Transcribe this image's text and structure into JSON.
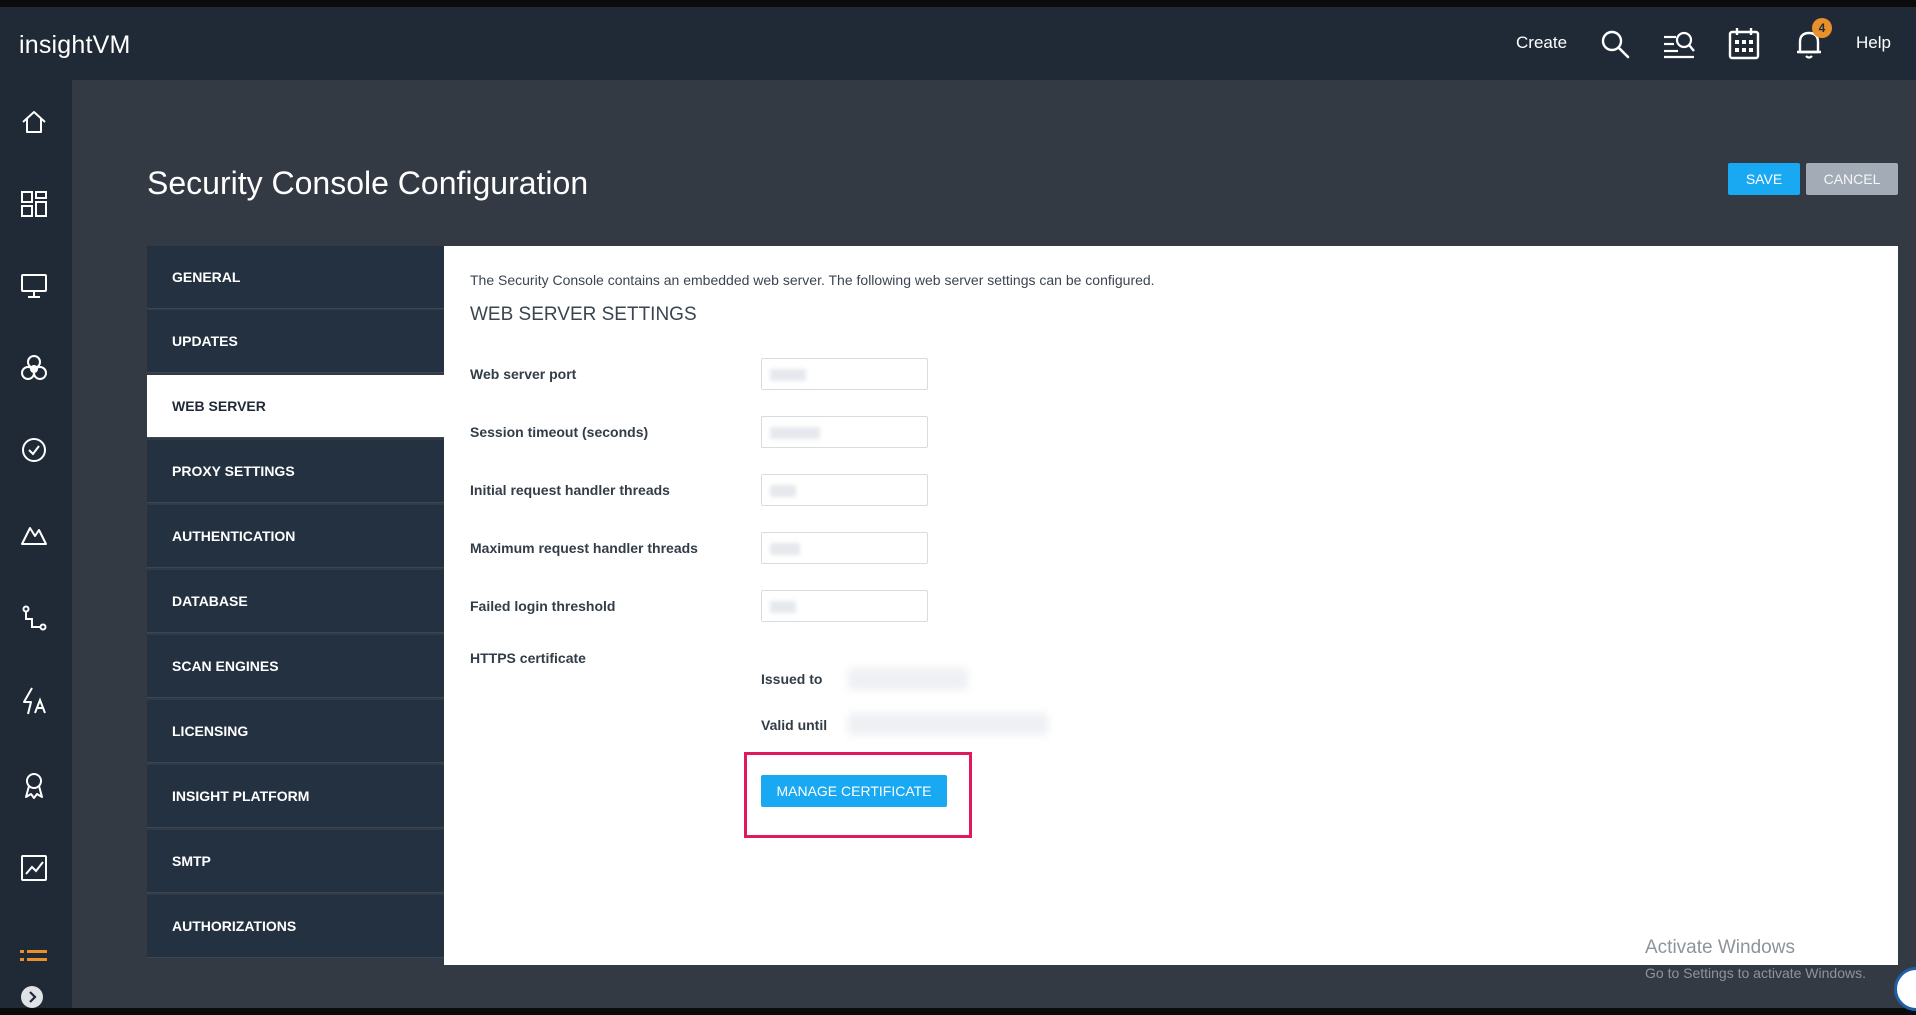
{
  "app": {
    "logo_light": "insight",
    "logo_bold": "VM"
  },
  "topbar": {
    "create_label": "Create",
    "help_label": "Help",
    "notification_count": "4"
  },
  "page": {
    "title": "Security Console Configuration",
    "save_label": "SAVE",
    "cancel_label": "CANCEL"
  },
  "settings_menu": {
    "items": [
      {
        "label": "GENERAL",
        "active": false
      },
      {
        "label": "UPDATES",
        "active": false
      },
      {
        "label": "WEB SERVER",
        "active": true
      },
      {
        "label": "PROXY SETTINGS",
        "active": false
      },
      {
        "label": "AUTHENTICATION",
        "active": false
      },
      {
        "label": "DATABASE",
        "active": false
      },
      {
        "label": "SCAN ENGINES",
        "active": false
      },
      {
        "label": "LICENSING",
        "active": false
      },
      {
        "label": "INSIGHT PLATFORM",
        "active": false
      },
      {
        "label": "SMTP",
        "active": false
      },
      {
        "label": "AUTHORIZATIONS",
        "active": false
      }
    ]
  },
  "web_server": {
    "intro": "The Security Console contains an embedded web server. The following web server settings can be configured.",
    "heading": "WEB SERVER SETTINGS",
    "fields": [
      {
        "label": "Web server port"
      },
      {
        "label": "Session timeout (seconds)"
      },
      {
        "label": "Initial request handler threads"
      },
      {
        "label": "Maximum request handler threads"
      },
      {
        "label": "Failed login threshold"
      }
    ],
    "https_label": "HTTPS certificate",
    "issued_to_label": "Issued to",
    "valid_until_label": "Valid until",
    "manage_label": "MANAGE CERTIFICATE"
  },
  "watermark": {
    "line1": "Activate Windows",
    "line2": "Go to Settings to activate Windows."
  },
  "colors": {
    "accent": "#19a9f2",
    "highlight": "#e0195a",
    "badge": "#e8912a",
    "nav_bg": "#1f2a36"
  }
}
